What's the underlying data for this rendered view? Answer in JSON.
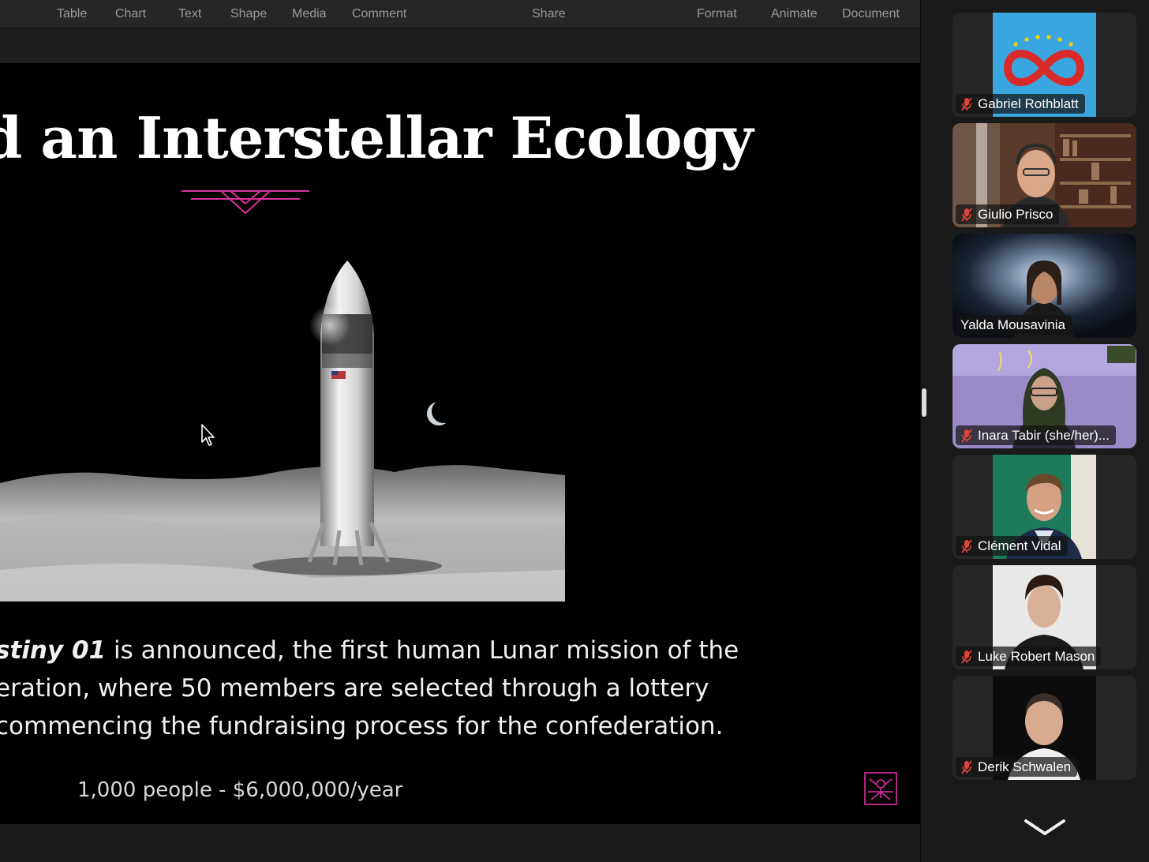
{
  "toolbar": {
    "items": [
      "Table",
      "Chart",
      "Text",
      "Shape",
      "Media",
      "Comment"
    ],
    "share": "Share",
    "right_items": [
      "Format",
      "Animate",
      "Document"
    ]
  },
  "slide": {
    "title": "d an Interstellar Ecology",
    "body_emph": "stiny 01",
    "body_line1_rest": " is announced, the first human Lunar mission of the",
    "body_line2": "eration, where 50 members are selected through a lottery",
    "body_line3": " commencing the fundraising process for the confederation.",
    "footer": "1,000 people - $6,000,000/year",
    "ornament_color": "#d7329b",
    "logo_color": "#c42a8f"
  },
  "participants": [
    {
      "name": "Gabriel Rothblatt",
      "muted": true,
      "active": false,
      "video": "infinity-logo"
    },
    {
      "name": "Giulio Prisco",
      "muted": true,
      "active": false,
      "video": "bookshelf-man"
    },
    {
      "name": "Yalda Mousavinia",
      "muted": false,
      "active": true,
      "video": "space-background"
    },
    {
      "name": "Inara Tabir (she/her)...",
      "muted": true,
      "active": false,
      "video": "purple-room"
    },
    {
      "name": "Clément Vidal",
      "muted": true,
      "active": false,
      "video": "green-wall"
    },
    {
      "name": "Luke Robert Mason",
      "muted": true,
      "active": false,
      "video": "avatar-render"
    },
    {
      "name": "Derik Schwalen",
      "muted": true,
      "active": false,
      "video": "dark-room"
    }
  ],
  "colors": {
    "active_border": "#3fd66a",
    "muted_mic": "#e0453a"
  }
}
